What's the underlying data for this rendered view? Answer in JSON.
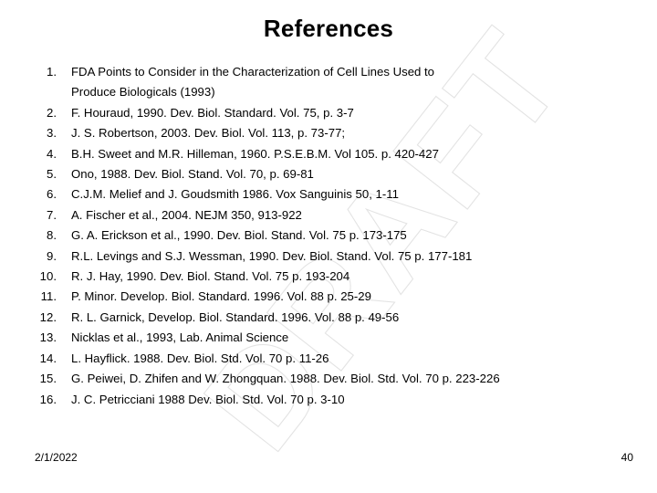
{
  "slide": {
    "title": "References",
    "watermark_text": "DRAFT",
    "watermark_color": "#e3e3e3",
    "background_color": "#ffffff",
    "text_color": "#000000"
  },
  "references": [
    {
      "number": "1.",
      "lines": [
        "FDA Points to Consider in the Characterization of Cell Lines Used to",
        "Produce Biologicals (1993)"
      ]
    },
    {
      "number": "2.",
      "lines": [
        "F. Houraud, 1990. Dev. Biol. Standard. Vol. 75, p. 3-7"
      ]
    },
    {
      "number": "3.",
      "lines": [
        "J. S. Robertson, 2003. Dev. Biol. Vol. 113, p. 73-77;"
      ]
    },
    {
      "number": "4.",
      "lines": [
        "B.H. Sweet and M.R. Hilleman, 1960. P.S.E.B.M. Vol 105. p. 420-427"
      ]
    },
    {
      "number": "5.",
      "lines": [
        "Ono, 1988. Dev. Biol. Stand. Vol. 70, p. 69-81"
      ]
    },
    {
      "number": "6.",
      "lines": [
        "C.J.M. Melief and J. Goudsmith 1986. Vox Sanguinis 50, 1-11"
      ]
    },
    {
      "number": "7.",
      "lines": [
        "A. Fischer et al., 2004. NEJM 350, 913-922"
      ]
    },
    {
      "number": "8.",
      "lines": [
        "G. A. Erickson et al., 1990. Dev. Biol. Stand. Vol. 75 p. 173-175"
      ]
    },
    {
      "number": "9.",
      "lines": [
        "R.L. Levings and S.J. Wessman, 1990. Dev. Biol. Stand. Vol. 75 p. 177-181"
      ]
    },
    {
      "number": "10.",
      "lines": [
        "R. J. Hay, 1990. Dev. Biol. Stand. Vol. 75 p. 193-204"
      ]
    },
    {
      "number": "11.",
      "lines": [
        "P. Minor. Develop. Biol. Standard. 1996. Vol. 88 p. 25-29"
      ]
    },
    {
      "number": "12.",
      "lines": [
        "R. L. Garnick, Develop. Biol. Standard. 1996. Vol. 88 p. 49-56"
      ]
    },
    {
      "number": "13.",
      "lines": [
        "Nicklas et al., 1993, Lab. Animal Science"
      ]
    },
    {
      "number": "14.",
      "lines": [
        "L. Hayflick. 1988. Dev. Biol. Std. Vol. 70 p.  11-26"
      ]
    },
    {
      "number": "15.",
      "lines": [
        "G. Peiwei, D. Zhifen and W. Zhongquan. 1988. Dev. Biol. Std. Vol. 70 p. 223-226"
      ]
    },
    {
      "number": "16.",
      "lines": [
        "J. C. Petricciani 1988 Dev. Biol. Std. Vol. 70 p. 3-10"
      ]
    }
  ],
  "footer": {
    "date": "2/1/2022",
    "page_number": "40"
  }
}
